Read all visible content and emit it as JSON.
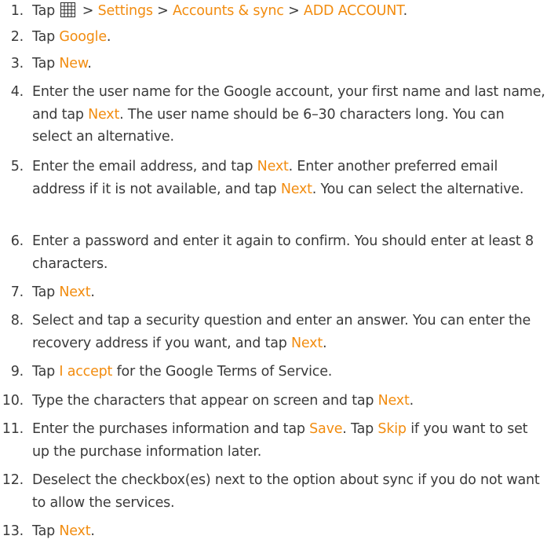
{
  "steps": [
    {
      "num": "1.",
      "parts": [
        {
          "t": "Tap "
        },
        {
          "icon": "apps-grid-icon"
        },
        {
          "t": " > "
        },
        {
          "t": "Settings",
          "hl": true
        },
        {
          "t": " > "
        },
        {
          "t": "Accounts & sync",
          "hl": true
        },
        {
          "t": " > "
        },
        {
          "t": "ADD ACCOUNT",
          "hl": true
        },
        {
          "t": "."
        }
      ]
    },
    {
      "num": "2.",
      "parts": [
        {
          "t": "Tap "
        },
        {
          "t": "Google",
          "hl": true
        },
        {
          "t": "."
        }
      ]
    },
    {
      "num": "3.",
      "parts": [
        {
          "t": "Tap "
        },
        {
          "t": "New",
          "hl": true
        },
        {
          "t": "."
        }
      ]
    },
    {
      "num": "4.",
      "parts": [
        {
          "t": "Enter the user name for the Google account, your first name and last name, and tap "
        },
        {
          "t": "Next",
          "hl": true
        },
        {
          "t": ". The user name should be 6–30 characters long. You can select an alternative."
        }
      ]
    },
    {
      "num": "5.",
      "parts": [
        {
          "t": "Enter the email address, and tap "
        },
        {
          "t": "Next",
          "hl": true
        },
        {
          "t": ". Enter another preferred email address if it is not available, and tap "
        },
        {
          "t": "Next",
          "hl": true
        },
        {
          "t": ". You can select the alternative."
        }
      ]
    },
    {
      "num": "6.",
      "parts": [
        {
          "t": "Enter a password and enter it again to confirm. You should enter at least 8 characters."
        }
      ]
    },
    {
      "num": "7.",
      "parts": [
        {
          "t": "Tap "
        },
        {
          "t": "Next",
          "hl": true
        },
        {
          "t": "."
        }
      ]
    },
    {
      "num": "8.",
      "parts": [
        {
          "t": "Select and tap a security question and enter an answer. You can enter the recovery address if you want, and tap "
        },
        {
          "t": "Next",
          "hl": true
        },
        {
          "t": "."
        }
      ]
    },
    {
      "num": "9.",
      "parts": [
        {
          "t": "Tap "
        },
        {
          "t": "I accept",
          "hl": true
        },
        {
          "t": " for the Google Terms of Service."
        }
      ]
    },
    {
      "num": "10.",
      "parts": [
        {
          "t": "Type the characters that appear on screen and tap "
        },
        {
          "t": "Next",
          "hl": true
        },
        {
          "t": "."
        }
      ]
    },
    {
      "num": "11.",
      "parts": [
        {
          "t": "Enter the purchases information and tap "
        },
        {
          "t": "Save",
          "hl": true
        },
        {
          "t": ". Tap "
        },
        {
          "t": "Skip",
          "hl": true
        },
        {
          "t": " if you want to set up the purchase information later."
        }
      ]
    },
    {
      "num": "12.",
      "parts": [
        {
          "t": "Deselect the checkbox(es) next to the option about sync if you do not want to allow the services."
        }
      ]
    },
    {
      "num": "13.",
      "parts": [
        {
          "t": "Tap "
        },
        {
          "t": "Next",
          "hl": true
        },
        {
          "t": "."
        }
      ]
    }
  ],
  "colors": {
    "text": "#3a3a3a",
    "highlight": "#f28c0f",
    "icon": "#2a2a2a"
  }
}
